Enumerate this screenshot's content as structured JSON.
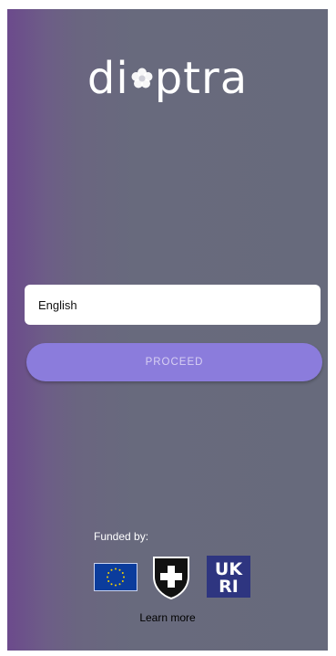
{
  "app": {
    "logo_text_left": "di",
    "logo_text_right": "ptra"
  },
  "language_select": {
    "value": "English"
  },
  "proceed_button": {
    "label": "PROCEED"
  },
  "footer": {
    "funded_label": "Funded by:",
    "funders": [
      {
        "icon": "eu-flag-icon"
      },
      {
        "icon": "swiss-shield-icon"
      },
      {
        "icon": "ukri-logo",
        "text": "UKRI"
      }
    ],
    "learn_more_label": "Learn more"
  },
  "colors": {
    "gradient_left": "#6c4a8c",
    "gradient_right": "#676a7c",
    "button": "#8b7cdc",
    "button_text": "#d8d0f3"
  }
}
